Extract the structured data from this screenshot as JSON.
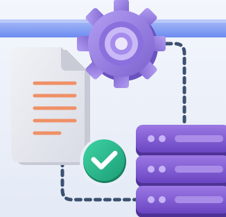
{
  "scene": {
    "icons": {
      "banner": "blue-header-bar",
      "gear": "gear-icon",
      "document": "document-icon",
      "check": "checkmark-badge-icon",
      "server": "server-stack-icon",
      "connector": "dashed-connector"
    },
    "colors": {
      "background_top": "#f3f6fc",
      "background_bottom": "#e4eaf6",
      "banner_light": "#9fb4f5",
      "banner": "#6d8cf0",
      "gear": "#9a83e6",
      "gear_dark": "#7b62cf",
      "gear_light": "#c9b9f7",
      "document": "#e7e9ef",
      "document_fold": "#c9ccd6",
      "document_lines": "#f09066",
      "check_badge": "#27b98c",
      "check_mark": "#ffffff",
      "server": "#7c55cf",
      "server_dark": "#5d3bab",
      "server_light": "#a98ce8",
      "connector": "#3b5170"
    }
  }
}
